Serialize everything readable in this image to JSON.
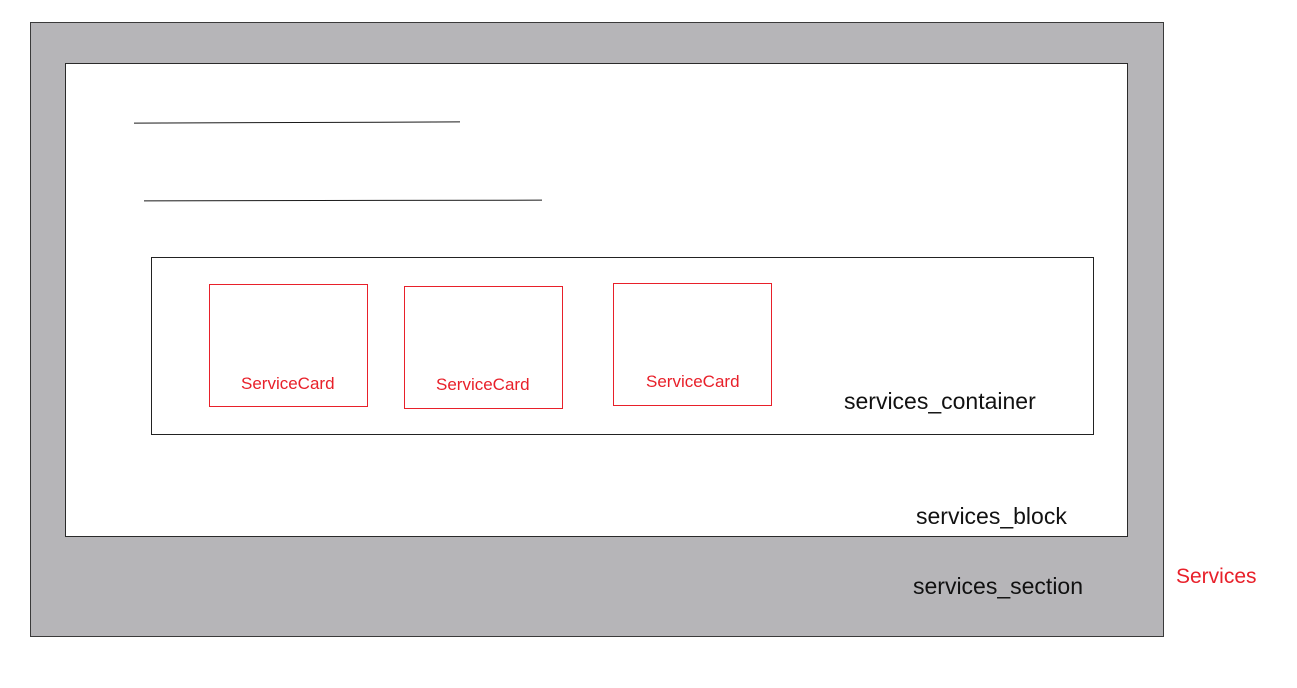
{
  "diagram": {
    "section_label": "services_section",
    "block_label": "services_block",
    "container_label": "services_container",
    "component_label": "Services",
    "cards": [
      {
        "label": "ServiceCard"
      },
      {
        "label": "ServiceCard"
      },
      {
        "label": "ServiceCard"
      }
    ]
  },
  "colors": {
    "section_fill": "#b6b5b8",
    "block_fill": "#ffffff",
    "card_border": "#e8202a",
    "component_label": "#e8202a",
    "text": "#111111"
  }
}
